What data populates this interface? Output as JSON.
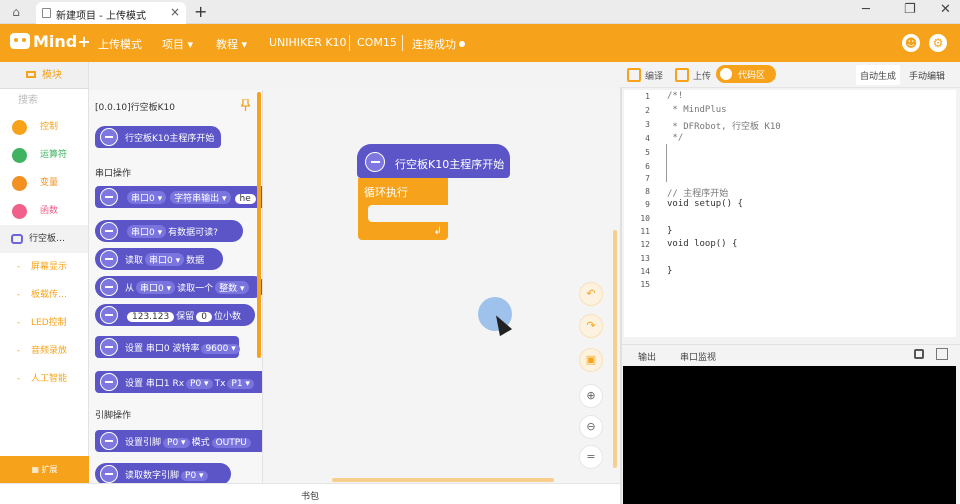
{
  "window": {
    "tab_title": "新建项目 - 上传模式",
    "tab_close": "×",
    "tab_add": "+",
    "controls": [
      "─",
      "❐",
      "✕"
    ]
  },
  "header": {
    "logo": "Mind+",
    "menu": [
      "上传模式",
      "项目 ▾",
      "教程 ▾",
      "UNIHIKER K10",
      "COM15",
      "连接成功"
    ],
    "accent": "#f6a31b"
  },
  "sidebar": {
    "title": "模块",
    "search_placeholder": "搜索",
    "categories": [
      {
        "label": "控制",
        "color": "#f6a31b"
      },
      {
        "label": "运算符",
        "color": "#3fb35f"
      },
      {
        "label": "变量",
        "color": "#f29024"
      },
      {
        "label": "函数",
        "color": "#f0608a"
      }
    ],
    "active_category": "行空板…",
    "subcategories": [
      "屏幕显示",
      "板载传…",
      "LED控制",
      "音频录放",
      "人工智能"
    ],
    "expand_label": "扩展"
  },
  "flyout": {
    "version_label": "[0.0.10]行空板K10",
    "sections": [
      "串口操作",
      "引脚操作"
    ],
    "blocks": {
      "main_start": "行空板K10主程序开始",
      "serial_out": {
        "port": "串口0 ▾",
        "mode": "字符串输出 ▾",
        "value": "he"
      },
      "serial_avail": {
        "port": "串口0 ▾",
        "text": "有数据可读?"
      },
      "read": {
        "pre": "读取",
        "port": "串口0 ▾",
        "post": "数据"
      },
      "read_one": {
        "pre": "从",
        "port": "串口0 ▾",
        "mid": "读取一个",
        "type": "整数 ▾"
      },
      "round": {
        "value": "123.123",
        "mid": "保留",
        "digits": "0",
        "post": "位小数"
      },
      "baud": {
        "pre": "设置 串口0 波特率",
        "value": "9600 ▾"
      },
      "set_serial1": {
        "pre": "设置 串口1 Rx",
        "rx": "P0 ▾",
        "mid": "Tx",
        "tx": "P1 ▾"
      },
      "set_pin": {
        "pre": "设置引脚",
        "pin": "P0 ▾",
        "mid": "模式",
        "mode": "OUTPU"
      },
      "read_digital": {
        "pre": "读取数字引脚",
        "pin": "P0 ▾"
      }
    }
  },
  "workspace": {
    "hat_label": "行空板K10主程序开始",
    "loop_label": "循环执行",
    "loop_arrow": "↲",
    "controls": [
      "↶",
      "↷",
      "▣",
      "⊕",
      "⊖",
      "="
    ]
  },
  "bottom": {
    "label": "书包"
  },
  "code_panel": {
    "toolbar": {
      "compile": "编译",
      "upload": "上传",
      "code_area": "代码区",
      "auto_gen": "自动生成",
      "manual_edit": "手动编辑"
    },
    "line_numbers": [
      "1",
      "2",
      "3",
      "4",
      "5",
      "6",
      "7",
      "8",
      "9",
      "10",
      "11",
      "12",
      "13",
      "14",
      "15"
    ],
    "lines": [
      "/*!",
      " * MindPlus",
      " * DFRobot, 行空板 K10",
      " */",
      "",
      "",
      "",
      "// 主程序开始",
      "void setup() {",
      "",
      "}",
      "void loop() {",
      "",
      "}",
      ""
    ],
    "output_tabs": [
      "输出",
      "串口监视"
    ]
  }
}
